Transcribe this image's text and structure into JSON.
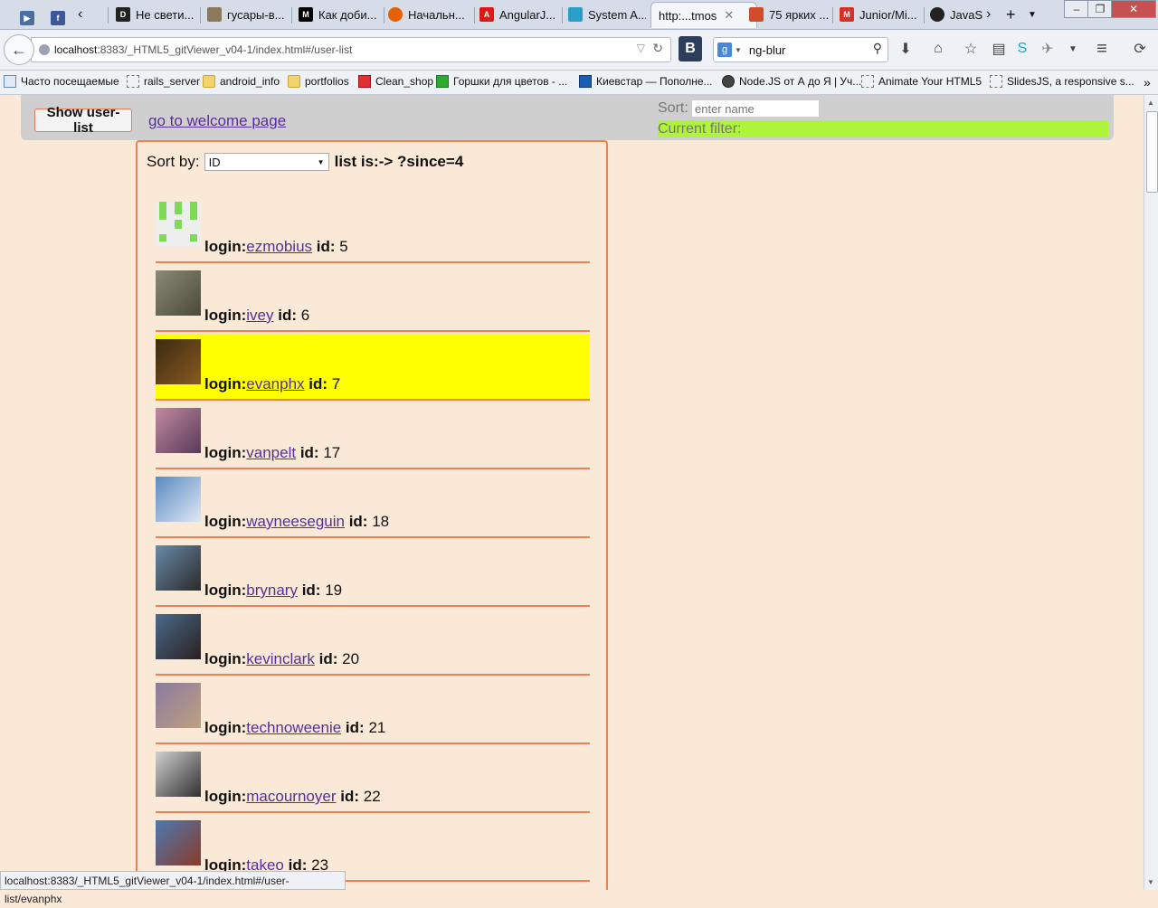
{
  "browser": {
    "tabs": [
      {
        "label": "Не свети..."
      },
      {
        "label": "гусары-в..."
      },
      {
        "label": "Как доби..."
      },
      {
        "label": "Начальн..."
      },
      {
        "label": "AngularJ..."
      },
      {
        "label": "System A..."
      },
      {
        "label": "http:...tmos"
      },
      {
        "label": "75 ярких ..."
      },
      {
        "label": "Junior/Mi..."
      },
      {
        "label": "JavaSc"
      }
    ],
    "url_host": "localhost",
    "url_rest": ":8383/_HTML5_gitViewer_v04-1/index.html#/user-list",
    "search_value": "ng-blur",
    "bookmarks": [
      {
        "label": "Часто посещаемые"
      },
      {
        "label": "rails_server"
      },
      {
        "label": "android_info"
      },
      {
        "label": "portfolios"
      },
      {
        "label": "Clean_shop"
      },
      {
        "label": "Горшки для цветов - ..."
      },
      {
        "label": "Киевстар — Пополне..."
      },
      {
        "label": "Node.JS от А до Я | Уч..."
      },
      {
        "label": "Animate Your HTML5"
      },
      {
        "label": "SlidesJS, a responsive s..."
      }
    ],
    "status_url": "localhost:8383/_HTML5_gitViewer_v04-1/index.html#/user-list/evanphx"
  },
  "header": {
    "show_button": "Show user-list",
    "welcome_link": "go to welcome page",
    "sort_label": "Sort:",
    "sort_placeholder": "enter name",
    "filter_label": "Current filter:"
  },
  "panel": {
    "sort_by_label": "Sort by:",
    "sort_selected": "ID",
    "list_is": "list is:-> ?since=4"
  },
  "labels": {
    "login": "login:",
    "id": "id:"
  },
  "users": [
    {
      "login": "ezmobius",
      "id": "5"
    },
    {
      "login": "ivey",
      "id": "6"
    },
    {
      "login": "evanphx",
      "id": "7"
    },
    {
      "login": "vanpelt",
      "id": "17"
    },
    {
      "login": "wayneeseguin",
      "id": "18"
    },
    {
      "login": "brynary",
      "id": "19"
    },
    {
      "login": "kevinclark",
      "id": "20"
    },
    {
      "login": "technoweenie",
      "id": "21"
    },
    {
      "login": "macournoyer",
      "id": "22"
    },
    {
      "login": "takeo",
      "id": "23"
    }
  ],
  "highlight_color": "#ffff00",
  "accent_color": "#f08050",
  "filter_color": "#aef43a"
}
